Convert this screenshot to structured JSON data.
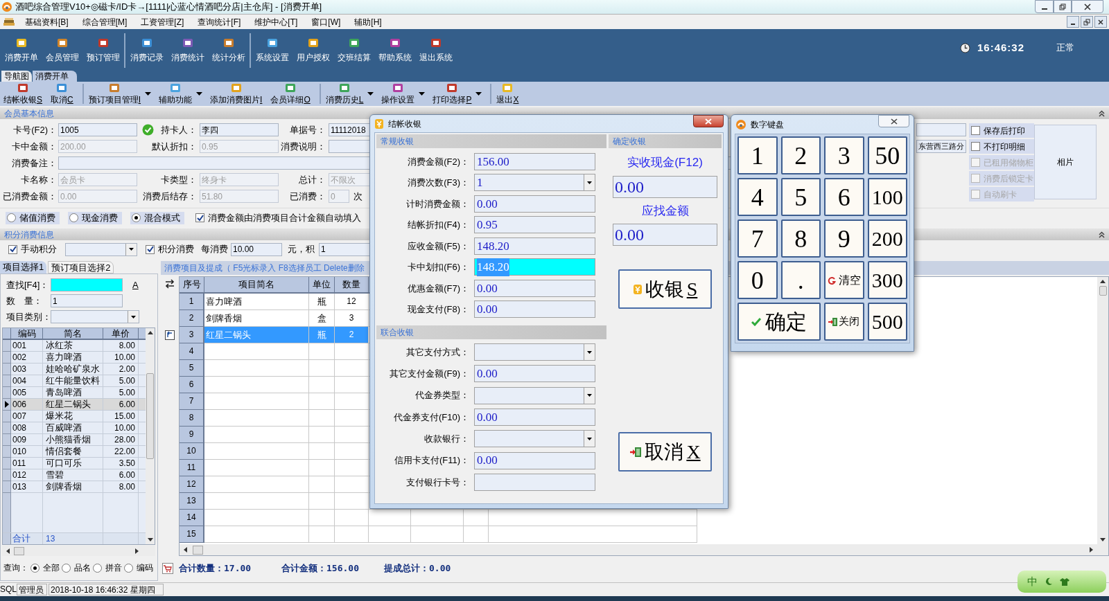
{
  "window": {
    "title": "酒吧综合管理V10+◎磁卡/ID卡→[1111|心蓝心情酒吧分店|主仓库] - [消费开单]"
  },
  "menu": [
    "基础资料[B]",
    "综合管理[M]",
    "工资管理[Z]",
    "查询统计[F]",
    "维护中心[T]",
    "窗口[W]",
    "辅助[H]"
  ],
  "toolbar": [
    [
      "消费开单",
      "会员管理",
      "预订管理"
    ],
    [
      "消费记录",
      "消费统计",
      "统计分析"
    ],
    [
      "系统设置",
      "用户授权",
      "交班结算",
      "帮助系统",
      "退出系统"
    ]
  ],
  "clock": "16:46:32",
  "mode": "正常",
  "tabs": [
    {
      "label": "导航图",
      "selected": false
    },
    {
      "label": "消费开单",
      "selected": true
    }
  ],
  "actions": [
    [
      {
        "label": "结帐收银",
        "hotkey": "S",
        "dropdown": false
      },
      {
        "label": "取消",
        "hotkey": "C",
        "dropdown": false
      }
    ],
    [
      {
        "label": "预订项目管理",
        "hotkey": "I",
        "dropdown": true
      },
      {
        "label": "辅助功能",
        "dropdown": true
      },
      {
        "label": "添加消费图片",
        "hotkey": "I",
        "dropdown": false
      },
      {
        "label": "会员详细",
        "hotkey": "O",
        "dropdown": false
      }
    ],
    [
      {
        "label": "消费历史",
        "hotkey": "L",
        "dropdown": true
      },
      {
        "label": "操作设置",
        "dropdown": true
      },
      {
        "label": "打印选择",
        "hotkey": "P",
        "dropdown": true
      }
    ],
    [
      {
        "label": "退出",
        "hotkey": "X",
        "dropdown": false
      }
    ]
  ],
  "member_section": {
    "title": "会员基本信息",
    "rows": [
      [
        {
          "label": "卡号(F2)：",
          "value": "1005",
          "disabled": false,
          "verified": true
        },
        {
          "label": "持卡人：",
          "value": "李四",
          "disabled": false
        },
        {
          "label": "单据号：",
          "value": "11112018",
          "disabled": false
        },
        {
          "disabled": false
        }
      ],
      [
        {
          "label": "卡中金额：",
          "value": "200.00",
          "disabled": true
        },
        {
          "label": "默认折扣：",
          "value": "0.95",
          "disabled": true
        },
        {
          "label": "消费说明：",
          "disabled": false
        },
        {
          "value": "东营西三路分",
          "disabled": false
        }
      ],
      [
        {
          "label": "消费备注：",
          "disabled": false,
          "wide": true
        }
      ],
      [
        {
          "label": "卡名称：",
          "value": "会员卡",
          "disabled": true
        },
        {
          "label": "卡类型：",
          "value": "终身卡",
          "disabled": true
        },
        {
          "label": "总计：",
          "value": "不限次",
          "disabled": true
        }
      ],
      [
        {
          "label": "已消费金额：",
          "value": "0.00",
          "disabled": true
        },
        {
          "label": "消费后结存：",
          "value": "51.80",
          "disabled": true
        },
        {
          "label": "已消费：",
          "value": "0",
          "disabled": true,
          "suffix": "次"
        }
      ]
    ]
  },
  "options": [
    {
      "label": "保存后打印",
      "checked": false,
      "disabled": false
    },
    {
      "label": "不打印明细",
      "checked": false,
      "disabled": false
    },
    {
      "label": "已租用储物柜",
      "checked": false,
      "disabled": true
    },
    {
      "label": "消费后锁定卡",
      "checked": false,
      "disabled": true
    },
    {
      "label": "自动刷卡",
      "checked": false,
      "disabled": true
    }
  ],
  "photo_label": "相片",
  "modes": [
    {
      "label": "储值消费",
      "selected": false
    },
    {
      "label": "现金消费",
      "selected": false
    },
    {
      "label": "混合模式",
      "selected": true
    }
  ],
  "auto_fill": {
    "label": "消费金额由消费项目合计金额自动填入",
    "checked": true
  },
  "points_section": {
    "title": "积分消费信息",
    "manual": {
      "label": "手动积分",
      "checked": true
    },
    "consume": {
      "label": "积分消费",
      "checked": true
    },
    "per_label": "每消费",
    "per_value": "10.00",
    "unit_label": "元，积",
    "points_value": "1"
  },
  "item_tabs": [
    {
      "label": "项目选择1",
      "selected": true
    },
    {
      "label": "预订项目选择2",
      "selected": false
    }
  ],
  "search": {
    "label": "查找[F4]：",
    "font_button": "A"
  },
  "quantity": {
    "label": "数　量：",
    "value": "1"
  },
  "category": {
    "label": "项目类别："
  },
  "items": {
    "columns": [
      "编码",
      "简名",
      "单价"
    ],
    "rows": [
      {
        "code": "001",
        "name": "冰红茶",
        "price": "8.00",
        "selected": false
      },
      {
        "code": "002",
        "name": "喜力啤酒",
        "price": "10.00",
        "selected": false
      },
      {
        "code": "003",
        "name": "娃哈哈矿泉水",
        "price": "2.00",
        "selected": false
      },
      {
        "code": "004",
        "name": "红牛能量饮料",
        "price": "5.00",
        "selected": false
      },
      {
        "code": "005",
        "name": "青岛啤酒",
        "price": "5.00",
        "selected": false
      },
      {
        "code": "006",
        "name": "红星二锅头",
        "price": "6.00",
        "selected": true
      },
      {
        "code": "007",
        "name": "爆米花",
        "price": "15.00",
        "selected": false
      },
      {
        "code": "008",
        "name": "百威啤酒",
        "price": "10.00",
        "selected": false
      },
      {
        "code": "009",
        "name": "小熊猫香烟",
        "price": "28.00",
        "selected": false
      },
      {
        "code": "010",
        "name": "情侣套餐",
        "price": "22.00",
        "selected": false
      },
      {
        "code": "011",
        "name": "可口可乐",
        "price": "3.50",
        "selected": false
      },
      {
        "code": "012",
        "name": "雪碧",
        "price": "6.00",
        "selected": false
      },
      {
        "code": "013",
        "name": "剑牌香烟",
        "price": "8.00",
        "selected": false
      }
    ],
    "footer": {
      "label": "合计",
      "count": "13"
    }
  },
  "query": {
    "label": "查询：",
    "options": [
      {
        "label": "全部",
        "selected": true
      },
      {
        "label": "品名",
        "selected": false
      },
      {
        "label": "拼音",
        "selected": false
      },
      {
        "label": "编码",
        "selected": false
      }
    ]
  },
  "order": {
    "hint": "消费项目及提成（ F5光标录入 F8选择员工 Delete删除",
    "columns": [
      "序号",
      "项目简名",
      "单位",
      "数量"
    ],
    "rows": [
      {
        "no": "1",
        "name": "喜力啤酒",
        "unit": "瓶",
        "qty": "12",
        "selected": false
      },
      {
        "no": "2",
        "name": "剑牌香烟",
        "unit": "盒",
        "qty": "3",
        "selected": false
      },
      {
        "no": "3",
        "name": "红星二锅头",
        "unit": "瓶",
        "qty": "2",
        "selected": true
      },
      {
        "no": "4",
        "selected": false
      },
      {
        "no": "5",
        "selected": false
      },
      {
        "no": "6",
        "selected": false
      },
      {
        "no": "7",
        "selected": false
      },
      {
        "no": "8",
        "selected": false
      },
      {
        "no": "9",
        "selected": false
      },
      {
        "no": "10",
        "selected": false
      },
      {
        "no": "11",
        "selected": false
      },
      {
        "no": "12",
        "selected": false
      },
      {
        "no": "13",
        "selected": false
      },
      {
        "no": "14",
        "selected": false
      },
      {
        "no": "15",
        "selected": false
      }
    ]
  },
  "totals": [
    "合计数量：17.00",
    "合计金额：156.00",
    "提成总计：0.00"
  ],
  "status_bar": [
    "SQL",
    "管理员",
    "2018-10-18 16:46:32 星期四"
  ],
  "ime": "中",
  "checkout_dialog": {
    "title": "结帐收银",
    "regular": {
      "title": "常规收银",
      "rows": [
        {
          "label": "消费金额(F2)：",
          "value": "156.00",
          "kind": "text",
          "focused": false
        },
        {
          "label": "消费次数(F3)：",
          "value": "1",
          "kind": "dropdown",
          "focused": false
        },
        {
          "label": "计时消费金额：",
          "value": "0.00",
          "kind": "text",
          "focused": false
        },
        {
          "label": "结帐折扣(F4)：",
          "value": "0.95",
          "kind": "text",
          "focused": false
        },
        {
          "label": "应收金额(F5)：",
          "value": "148.20",
          "kind": "text",
          "focused": false
        },
        {
          "label": "卡中划扣(F6)：",
          "value": "148.20",
          "kind": "text",
          "focused": true
        },
        {
          "label": "优惠金额(F7)：",
          "value": "0.00",
          "kind": "text",
          "focused": false
        },
        {
          "label": "现金支付(F8)：",
          "value": "0.00",
          "kind": "text",
          "focused": false
        }
      ]
    },
    "combined": {
      "title": "联合收银",
      "rows": [
        {
          "label": "其它支付方式：",
          "kind": "dropdown",
          "focused": false
        },
        {
          "label": "其它支付金额(F9)：",
          "value": "0.00",
          "kind": "text",
          "focused": false
        },
        {
          "label": "代金券类型：",
          "kind": "dropdown",
          "focused": false
        },
        {
          "label": "代金券支付(F10)：",
          "value": "0.00",
          "kind": "text",
          "focused": false
        },
        {
          "label": "收款银行：",
          "kind": "dropdown",
          "focused": false
        },
        {
          "label": "信用卡支付(F11)：",
          "value": "0.00",
          "kind": "text",
          "focused": false
        },
        {
          "label": "支付银行卡号：",
          "kind": "text",
          "focused": false
        }
      ]
    },
    "confirm": {
      "title": "确定收银",
      "cash_label": "实收现金(F12)",
      "cash_value": "0.00",
      "change_label": "应找金额",
      "change_value": "0.00"
    },
    "buttons": [
      {
        "label": "收银",
        "hotkey": "S",
        "kind": "pay"
      },
      {
        "label": "取消",
        "hotkey": "X",
        "kind": "cancel"
      }
    ]
  },
  "keypad": {
    "title": "数字键盘",
    "keys": [
      {
        "label": "1",
        "kind": "digit"
      },
      {
        "label": "2",
        "kind": "digit"
      },
      {
        "label": "3",
        "kind": "digit"
      },
      {
        "label": "50",
        "kind": "digit"
      },
      {
        "label": "4",
        "kind": "digit"
      },
      {
        "label": "5",
        "kind": "digit"
      },
      {
        "label": "6",
        "kind": "digit"
      },
      {
        "label": "100",
        "kind": "digit"
      },
      {
        "label": "7",
        "kind": "digit"
      },
      {
        "label": "8",
        "kind": "digit"
      },
      {
        "label": "9",
        "kind": "digit"
      },
      {
        "label": "200",
        "kind": "digit"
      },
      {
        "label": "0",
        "kind": "digit"
      },
      {
        "label": ".",
        "kind": "digit"
      },
      {
        "label": "清空",
        "kind": "clear"
      },
      {
        "label": "300",
        "kind": "digit"
      },
      {
        "label": "确定",
        "kind": "confirm"
      },
      {
        "label": "关闭",
        "kind": "close"
      },
      {
        "label": "500",
        "kind": "digit"
      }
    ]
  }
}
